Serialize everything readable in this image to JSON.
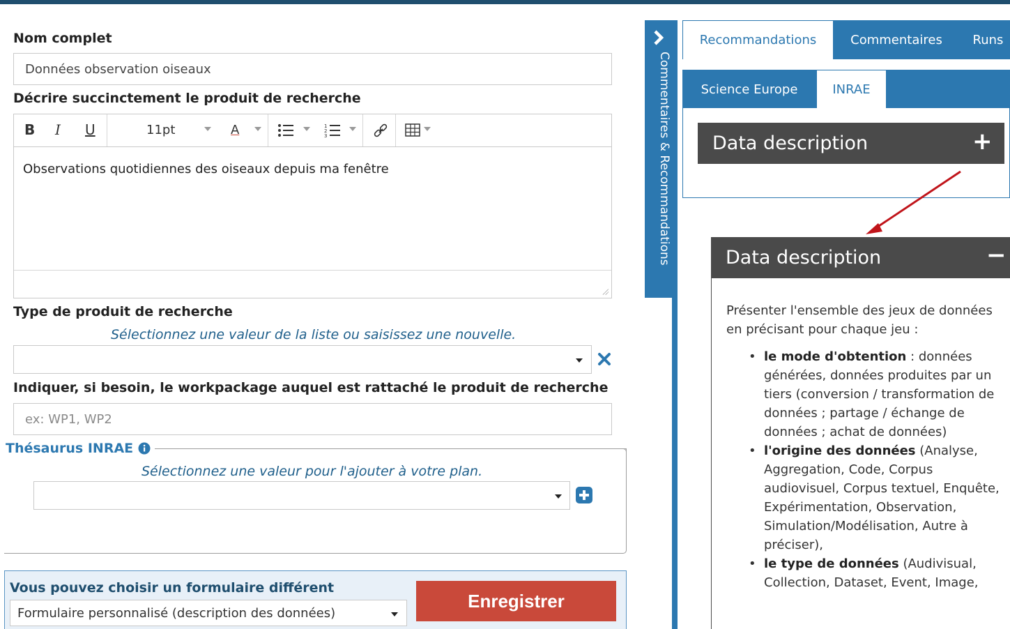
{
  "form": {
    "full_name_label": "Nom complet",
    "full_name_value": "Données observation oiseaux",
    "describe_label": "Décrire succinctement le produit de recherche",
    "editor": {
      "bold": "B",
      "italic": "I",
      "underline": "U",
      "font_size": "11pt",
      "font_color": "A",
      "content": "Observations quotidiennes des oiseaux depuis ma fenêtre"
    },
    "type_label": "Type de produit de recherche",
    "type_hint": "Sélectionnez une valeur de la liste ou saisissez une nouvelle.",
    "type_value": "",
    "workpackage_label": "Indiquer, si besoin, le workpackage auquel est rattaché le produit de recherche",
    "workpackage_placeholder": "ex: WP1, WP2",
    "thesaurus_legend": "Thésaurus INRAE",
    "thesaurus_hint": "Sélectionnez une valeur pour l'ajouter à votre plan.",
    "thesaurus_value": ""
  },
  "bottom": {
    "choose_form_label": "Vous pouvez choisir un formulaire différent",
    "form_select_value": "Formulaire personnalisé (description des données)",
    "save_button": "Enregistrer"
  },
  "side_tab": {
    "label": "Commentaires & Recommandations"
  },
  "right": {
    "tabs": [
      {
        "label": "Recommandations",
        "active": true
      },
      {
        "label": "Commentaires",
        "active": false
      },
      {
        "label": "Runs",
        "active": false
      }
    ],
    "subtabs": [
      {
        "label": "Science Europe",
        "active": false
      },
      {
        "label": "INRAE",
        "active": true
      }
    ],
    "collapsed_header": "Data description",
    "expand_sign": "+",
    "expanded_header": "Data description",
    "collapse_sign": "−",
    "intro": "Présenter l'ensemble des jeux de données en précisant pour chaque jeu :",
    "items": [
      {
        "bold": "le mode d'obtention",
        "rest": " : données générées, données produites par un tiers (conversion / transformation de données ; partage / échange de données ; achat de données)"
      },
      {
        "bold": "l'origine des données",
        "rest": " (Analyse, Aggregation, Code, Corpus audiovisuel, Corpus textuel, Enquête, Expérimentation, Observation, Simulation/Modélisation, Autre à préciser),"
      },
      {
        "bold": "le type de données",
        "rest": " (Audivisual, Collection, Dataset, Event, Image,"
      }
    ]
  },
  "colors": {
    "primary_blue": "#2c78b0",
    "save_red": "#c9493a",
    "dark_header": "#4a4a4a",
    "arrow_red": "#c0141a"
  }
}
